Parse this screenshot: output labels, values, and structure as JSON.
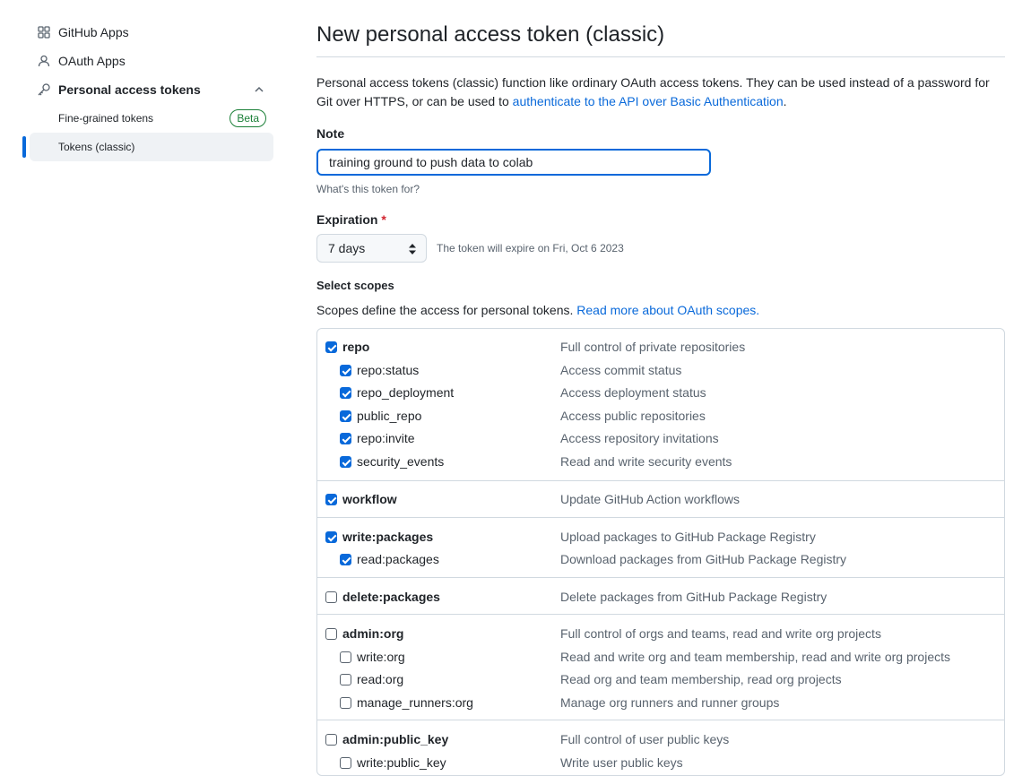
{
  "sidebar": {
    "items": [
      {
        "label": "GitHub Apps",
        "icon": "apps-grid-icon"
      },
      {
        "label": "OAuth Apps",
        "icon": "person-icon"
      },
      {
        "label": "Personal access tokens",
        "icon": "key-icon"
      },
      {
        "label": "Fine-grained tokens",
        "badge": "Beta"
      },
      {
        "label": "Tokens (classic)",
        "active": true
      }
    ]
  },
  "page": {
    "title": "New personal access token (classic)",
    "intro_text": "Personal access tokens (classic) function like ordinary OAuth access tokens. They can be used instead of a password for Git over HTTPS, or can be used to ",
    "intro_link": "authenticate to the API over Basic Authentication",
    "intro_end": "."
  },
  "note": {
    "label": "Note",
    "value": "training ground to push data to colab",
    "hint": "What's this token for?"
  },
  "expiration": {
    "label": "Expiration",
    "required_mark": "*",
    "selected": "7 days",
    "message": "The token will expire on Fri, Oct 6 2023"
  },
  "scopes": {
    "label": "Select scopes",
    "description": "Scopes define the access for personal tokens. ",
    "link": "Read more about OAuth scopes.",
    "groups": [
      {
        "name": "repo",
        "desc": "Full control of private repositories",
        "checked": true,
        "children": [
          {
            "name": "repo:status",
            "desc": "Access commit status",
            "checked": true
          },
          {
            "name": "repo_deployment",
            "desc": "Access deployment status",
            "checked": true
          },
          {
            "name": "public_repo",
            "desc": "Access public repositories",
            "checked": true
          },
          {
            "name": "repo:invite",
            "desc": "Access repository invitations",
            "checked": true
          },
          {
            "name": "security_events",
            "desc": "Read and write security events",
            "checked": true
          }
        ]
      },
      {
        "name": "workflow",
        "desc": "Update GitHub Action workflows",
        "checked": true,
        "children": []
      },
      {
        "name": "write:packages",
        "desc": "Upload packages to GitHub Package Registry",
        "checked": true,
        "children": [
          {
            "name": "read:packages",
            "desc": "Download packages from GitHub Package Registry",
            "checked": true
          }
        ]
      },
      {
        "name": "delete:packages",
        "desc": "Delete packages from GitHub Package Registry",
        "checked": false,
        "children": []
      },
      {
        "name": "admin:org",
        "desc": "Full control of orgs and teams, read and write org projects",
        "checked": false,
        "children": [
          {
            "name": "write:org",
            "desc": "Read and write org and team membership, read and write org projects",
            "checked": false
          },
          {
            "name": "read:org",
            "desc": "Read org and team membership, read org projects",
            "checked": false
          },
          {
            "name": "manage_runners:org",
            "desc": "Manage org runners and runner groups",
            "checked": false
          }
        ]
      },
      {
        "name": "admin:public_key",
        "desc": "Full control of user public keys",
        "checked": false,
        "children": [
          {
            "name": "write:public_key",
            "desc": "Write user public keys",
            "checked": false
          }
        ]
      }
    ]
  },
  "colors": {
    "accent": "#0969da",
    "success": "#1a7f37",
    "danger": "#d1242f"
  }
}
